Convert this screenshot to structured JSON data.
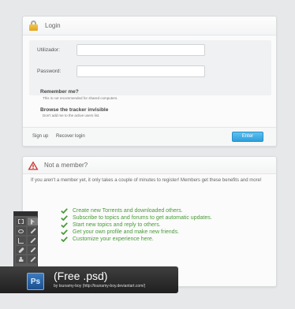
{
  "login": {
    "title": "Login",
    "username_label": "Utilizador:",
    "username_value": "",
    "password_label": "Password:",
    "password_value": "",
    "remember_title": "Remember me?",
    "remember_desc": "This is not recommended for shared computers.",
    "invisible_title": "Browse the tracker invisible",
    "invisible_desc": "Don't add me to the active users list.",
    "signup": "Sign up",
    "recover": "Recover login",
    "enter": "Enter"
  },
  "member": {
    "title": "Not a member?",
    "intro": "If you aren't a member yet, it only takes a couple of minutes to register! Members get these benefits and more!",
    "perks": [
      "Create new Torrents and downloaded others.",
      "Subscribe to topics and forums to get automatic updates.",
      "Start new topics and reply to others.",
      "Get your own profile and make new friends.",
      "Customize your experience here."
    ]
  },
  "banner": {
    "logo": "Ps",
    "title": "(Free .psd)",
    "credit": "by tsunamy-boy (http://tsunamy-boy.deviantart.com/)"
  },
  "colors": {
    "accent_button": "#2d9fdc",
    "perk_text": "#4a9a3a",
    "warning": "#c8302c",
    "lock": "#e0a521"
  }
}
